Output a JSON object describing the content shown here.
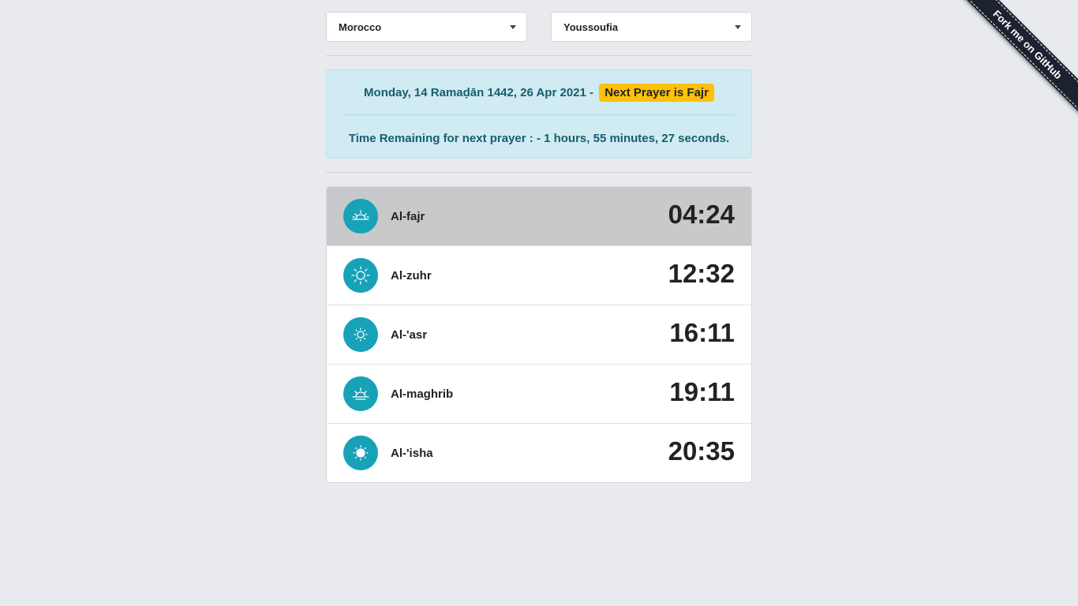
{
  "selects": {
    "country": "Morocco",
    "city": "Youssoufia"
  },
  "alert": {
    "date_text": "Monday, 14 Ramaḍān 1442, 26 Apr 2021 -",
    "next_prayer_badge": "Next Prayer is Fajr",
    "remaining_label": "Time Remaining for next prayer :",
    "remaining_value": "- 1 hours, 55 minutes, 27 seconds."
  },
  "prayers": [
    {
      "name": "Al-fajr",
      "time": "04:24",
      "icon": "sunrise-icon",
      "active": true
    },
    {
      "name": "Al-zuhr",
      "time": "12:32",
      "icon": "sun-icon",
      "active": false
    },
    {
      "name": "Al-'asr",
      "time": "16:11",
      "icon": "sun-small-icon",
      "active": false
    },
    {
      "name": "Al-maghrib",
      "time": "19:11",
      "icon": "sunset-icon",
      "active": false
    },
    {
      "name": "Al-'isha",
      "time": "20:35",
      "icon": "sun-filled-icon",
      "active": false
    }
  ],
  "ribbon": {
    "label": "Fork me on GitHub"
  },
  "colors": {
    "background": "#e9eaee",
    "accent": "#17a2b8",
    "alert_bg": "#d0ebf1",
    "alert_text": "#155e6f",
    "badge": "#ffc107",
    "active_row": "#c8c9ca",
    "ribbon": "#1c2230"
  }
}
